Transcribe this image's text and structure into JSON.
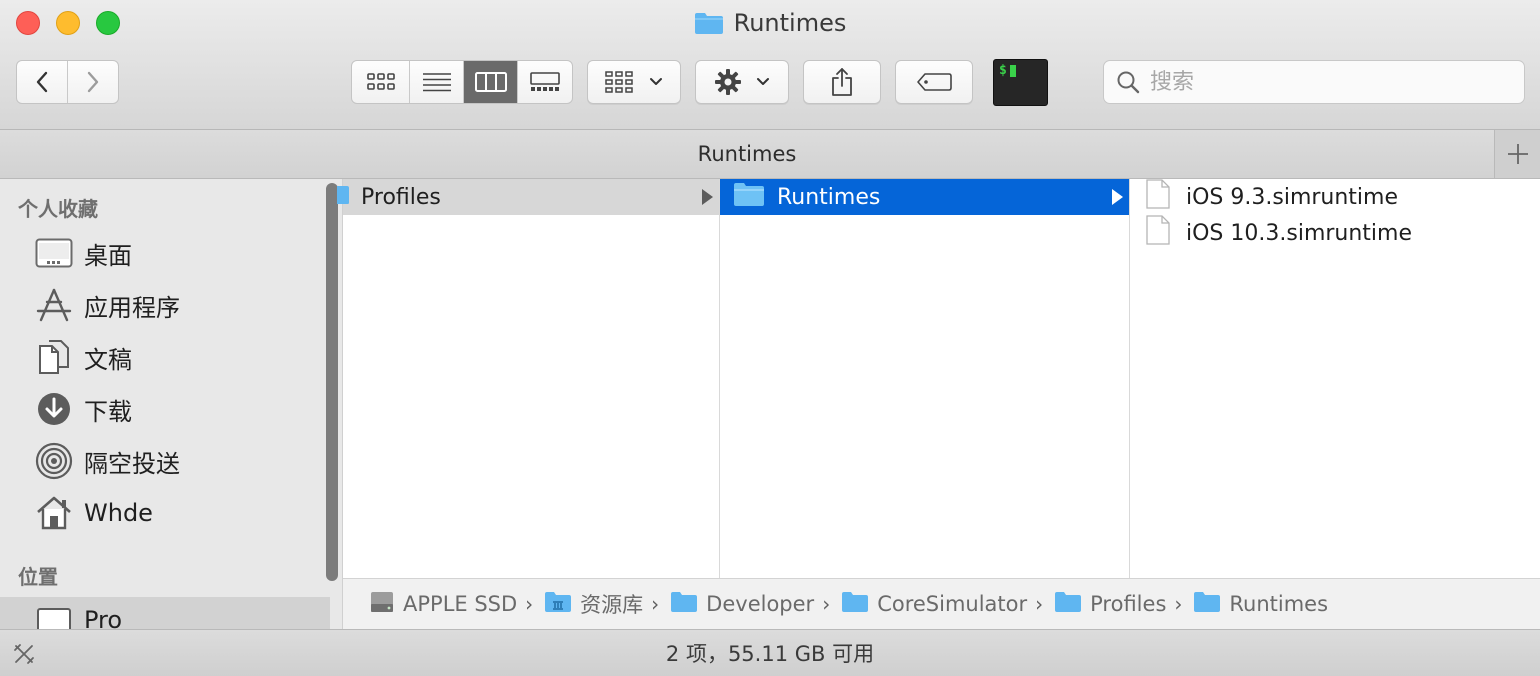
{
  "window": {
    "title": "Runtimes"
  },
  "toolbar": {
    "back_label": "‹",
    "forward_label": "›",
    "view_modes": [
      "icon",
      "list",
      "column",
      "gallery"
    ],
    "active_view": "column",
    "search_placeholder": "搜索",
    "terminal_label": "$"
  },
  "tabbar": {
    "title": "Runtimes",
    "add_label": "+"
  },
  "sidebar": {
    "favorites_header": "个人收藏",
    "favorites": [
      {
        "label": "桌面",
        "icon": "desktop-icon"
      },
      {
        "label": "应用程序",
        "icon": "applications-icon"
      },
      {
        "label": "文稿",
        "icon": "documents-icon"
      },
      {
        "label": "下载",
        "icon": "downloads-icon"
      },
      {
        "label": "隔空投送",
        "icon": "airdrop-icon"
      },
      {
        "label": "Whde",
        "icon": "home-icon"
      }
    ],
    "locations_header": "位置",
    "locations": [
      {
        "label": "Pro",
        "icon": "computer-icon",
        "selected": true
      }
    ]
  },
  "columns": {
    "col1": [
      {
        "label": "Profiles",
        "state": "parent-selected",
        "has_children": true
      }
    ],
    "col2": [
      {
        "label": "Runtimes",
        "state": "selected",
        "has_children": true
      }
    ],
    "col3": [
      {
        "label": "iOS 9.3.simruntime"
      },
      {
        "label": "iOS 10.3.simruntime"
      }
    ]
  },
  "pathbar": {
    "items": [
      {
        "label": "APPLE SSD",
        "icon": "disk-icon"
      },
      {
        "label": "资源库",
        "icon": "library-folder-icon"
      },
      {
        "label": "Developer",
        "icon": "folder-icon"
      },
      {
        "label": "CoreSimulator",
        "icon": "folder-icon"
      },
      {
        "label": "Profiles",
        "icon": "folder-icon"
      },
      {
        "label": "Runtimes",
        "icon": "folder-icon"
      }
    ],
    "separator": "›"
  },
  "statusbar": {
    "text": "2 项，55.11 GB 可用"
  },
  "colors": {
    "selection_blue": "#0565d8",
    "folder_blue": "#5fb6f1",
    "close": "#fe5f57",
    "minimize": "#febc2e",
    "maximize": "#28c840"
  }
}
